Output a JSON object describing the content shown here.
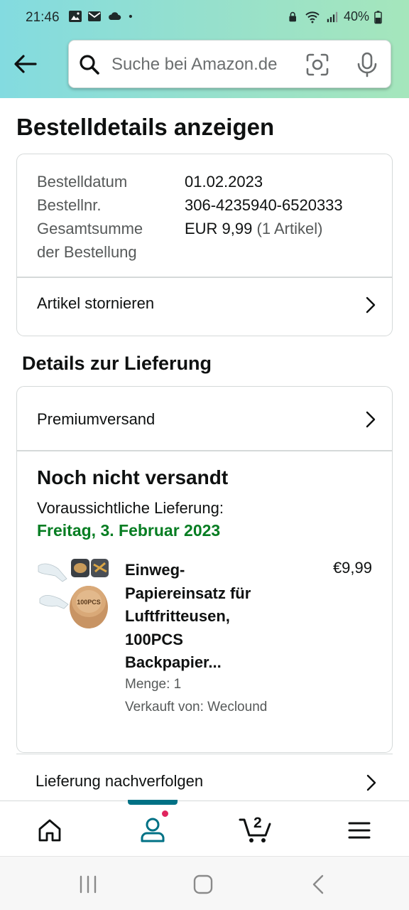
{
  "status_bar": {
    "time": "21:46",
    "battery": "40%",
    "left_icons": [
      "image-icon",
      "mail-icon",
      "cloud-icon",
      "dot-icon"
    ],
    "right_icons": [
      "lock-icon",
      "wifi-icon",
      "signal-icon",
      "battery-icon"
    ]
  },
  "header": {
    "search_placeholder": "Suche bei Amazon.de"
  },
  "page": {
    "title": "Bestelldetails anzeigen"
  },
  "order": {
    "rows": [
      {
        "key": "Bestelldatum",
        "value": "01.02.2023",
        "extra": ""
      },
      {
        "key": "Bestellnr.",
        "value": "306-4235940-6520333",
        "extra": ""
      },
      {
        "key": "Gesamtsumme",
        "value": "EUR 9,99",
        "extra": "(1 Artikel)"
      },
      {
        "key": "der Bestellung",
        "value": "",
        "extra": ""
      }
    ],
    "cancel_label": "Artikel stornieren"
  },
  "delivery": {
    "section_title": "Details zur Lieferung",
    "shipping_method": "Premiumversand",
    "status": "Noch nicht versandt",
    "expected_label": "Voraussichtliche Lieferung:",
    "expected_date": "Freitag, 3. Februar 2023",
    "product": {
      "title_lines": [
        "Einweg-",
        "Papiereinsatz für",
        "Luftfritteusen,",
        "100PCS",
        "Backpapier..."
      ],
      "price": "€9,99",
      "quantity": "Menge: 1",
      "seller": "Verkauft von: Weclound",
      "image_text": "100PCS"
    },
    "track_label": "Lieferung nachverfolgen"
  },
  "bottom_nav": {
    "items": [
      "home-icon",
      "account-icon",
      "cart-icon",
      "menu-icon"
    ],
    "active": "account-icon",
    "cart_count": "2"
  },
  "colors": {
    "accent_teal": "#007185",
    "delivery_green": "#067d22",
    "badge_pink": "#e0245e"
  }
}
